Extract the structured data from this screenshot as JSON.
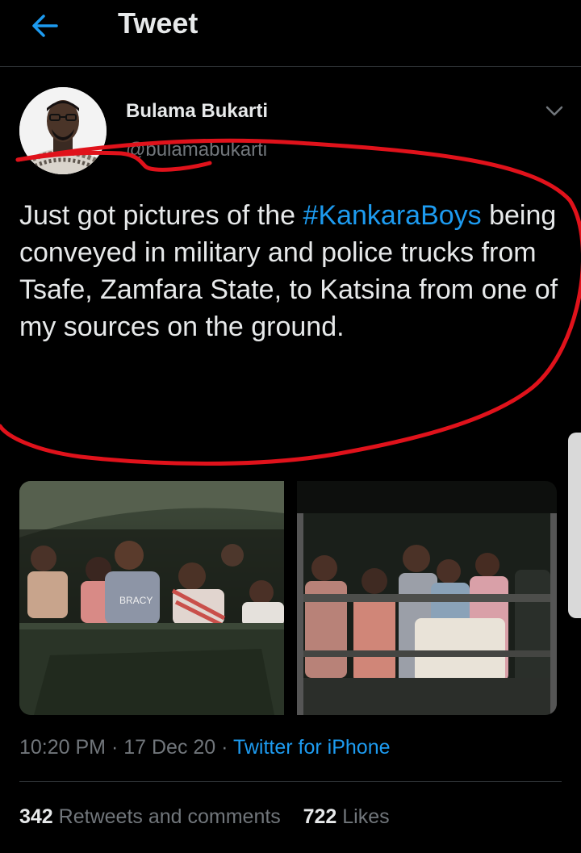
{
  "header": {
    "title": "Tweet"
  },
  "author": {
    "name": "Bulama Bukarti",
    "handle": "@bulamabukarti"
  },
  "tweet": {
    "text_before": "Just got pictures of the ",
    "hashtag": "#KankaraBoys",
    "text_after": " being conveyed in military and police trucks from Tsafe, Zamfara State, to Katsina from one of my sources on the ground."
  },
  "media": {
    "shirt_text": "BRACY"
  },
  "meta": {
    "time": "10:20 PM",
    "sep1": " · ",
    "date": "17 Dec 20",
    "sep2": " · ",
    "source": "Twitter for iPhone"
  },
  "stats": {
    "retweets_count": "342",
    "retweets_label": "Retweets and comments",
    "likes_count": "722",
    "likes_label": "Likes"
  },
  "colors": {
    "accent": "#1d9bf0",
    "annotation": "#e0121b"
  }
}
